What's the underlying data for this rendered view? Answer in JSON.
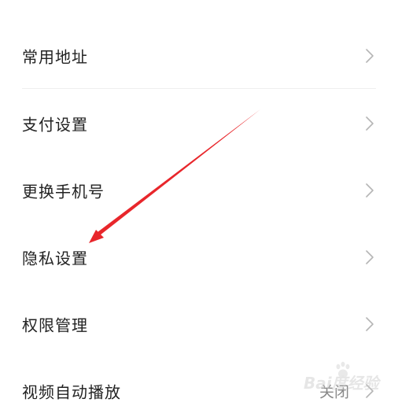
{
  "settings": {
    "items": [
      {
        "label": "常用地址",
        "value": ""
      },
      {
        "label": "支付设置",
        "value": ""
      },
      {
        "label": "更换手机号",
        "value": ""
      },
      {
        "label": "隐私设置",
        "value": ""
      },
      {
        "label": "权限管理",
        "value": ""
      },
      {
        "label": "视频自动播放",
        "value": "关闭"
      }
    ]
  },
  "icons": {
    "row_arrow": "chevron-right-icon",
    "annotation": "red-arrow"
  },
  "colors": {
    "annotation_arrow": "#e8262b",
    "label_text": "#222222",
    "secondary_text": "#888888",
    "chevron": "#b5b5b5",
    "divider": "#eeeeee"
  },
  "watermark": {
    "text": "Bai度经验"
  }
}
